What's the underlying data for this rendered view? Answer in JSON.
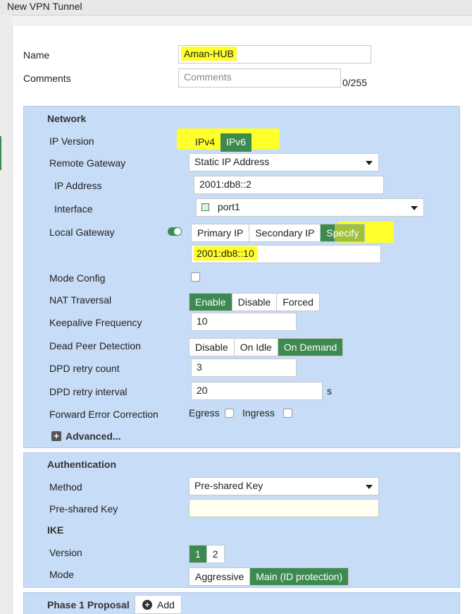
{
  "window": {
    "title": "New VPN Tunnel"
  },
  "name_field": {
    "label": "Name",
    "value": "Aman-HUB"
  },
  "comments_field": {
    "label": "Comments",
    "placeholder": "Comments",
    "counter": "0/255"
  },
  "network": {
    "heading": "Network",
    "ip_version": {
      "label": "IP Version",
      "options": [
        "IPv4",
        "IPv6"
      ],
      "selected": "IPv6"
    },
    "remote_gateway": {
      "label": "Remote Gateway",
      "value": "Static IP Address"
    },
    "ip_address": {
      "label": "IP Address",
      "value": "2001:db8::2"
    },
    "interface": {
      "label": "Interface",
      "value": "port1"
    },
    "local_gateway": {
      "label": "Local Gateway",
      "enabled": true,
      "options": [
        "Primary IP",
        "Secondary IP",
        "Specify"
      ],
      "selected": "Specify",
      "value": "2001:db8::10"
    },
    "mode_config": {
      "label": "Mode Config",
      "checked": false
    },
    "nat_traversal": {
      "label": "NAT Traversal",
      "options": [
        "Enable",
        "Disable",
        "Forced"
      ],
      "selected": "Enable"
    },
    "keepalive": {
      "label": "Keepalive Frequency",
      "value": "10"
    },
    "dpd": {
      "label": "Dead Peer Detection",
      "options": [
        "Disable",
        "On Idle",
        "On Demand"
      ],
      "selected": "On Demand"
    },
    "dpd_retry_count": {
      "label": "DPD retry count",
      "value": "3"
    },
    "dpd_retry_interval": {
      "label": "DPD retry interval",
      "value": "20",
      "unit": "s"
    },
    "fec": {
      "label": "Forward Error Correction",
      "egress": "Egress",
      "ingress": "Ingress"
    },
    "advanced": {
      "label": "Advanced..."
    }
  },
  "authentication": {
    "heading": "Authentication",
    "method": {
      "label": "Method",
      "value": "Pre-shared Key"
    },
    "psk": {
      "label": "Pre-shared Key",
      "value": ""
    }
  },
  "ike": {
    "heading": "IKE",
    "version": {
      "label": "Version",
      "options": [
        "1",
        "2"
      ],
      "selected": "1"
    },
    "mode": {
      "label": "Mode",
      "options": [
        "Aggressive",
        "Main (ID protection)"
      ],
      "selected": "Main (ID protection)"
    }
  },
  "phase1": {
    "heading": "Phase 1 Proposal",
    "add_label": "Add"
  },
  "colors": {
    "accent": "#3c8a4f",
    "section_bg": "#c7dcf7",
    "highlight": "#ffff2a"
  }
}
